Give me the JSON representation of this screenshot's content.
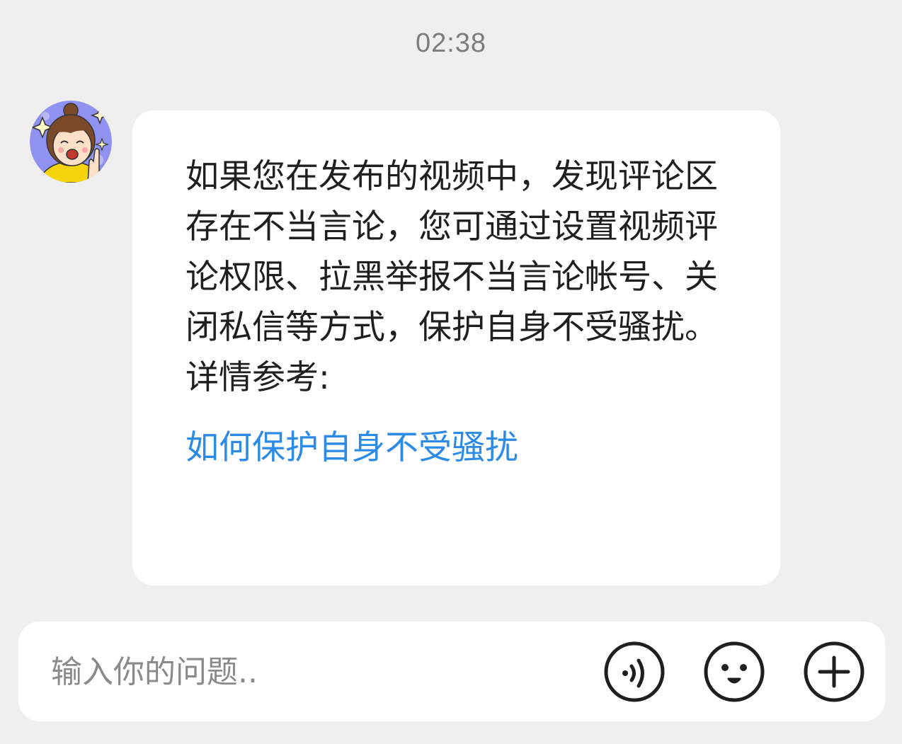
{
  "chat": {
    "timestamp": "02:38",
    "messages": [
      {
        "sender_avatar": "cartoon-girl-avatar",
        "text": "如果您在发布的视频中，发现评论区存在不当言论，您可通过设置视频评论权限、拉黑举报不当言论帐号、关闭私信等方式，保护自身不受骚扰。",
        "reference_label": "详情参考:",
        "link_text": "如何保护自身不受骚扰",
        "link_color": "#2c8be6"
      }
    ]
  },
  "input_bar": {
    "placeholder": "输入你的问题..",
    "value": "",
    "buttons": [
      {
        "icon": "voice-icon"
      },
      {
        "icon": "emoji-icon"
      },
      {
        "icon": "plus-icon"
      }
    ]
  },
  "colors": {
    "background": "#efefef",
    "bubble": "#ffffff",
    "link": "#2c8be6",
    "text": "#1f1f1f"
  }
}
